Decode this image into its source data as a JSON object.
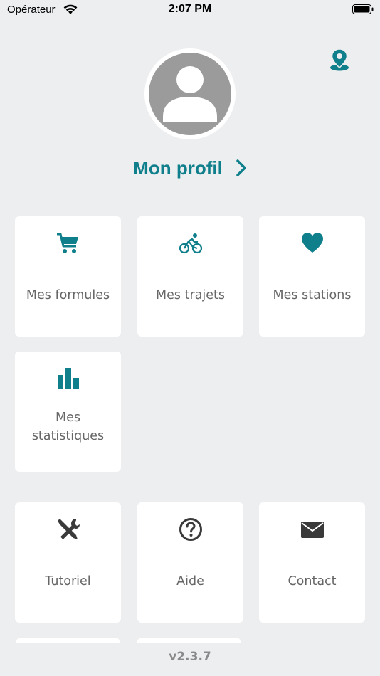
{
  "status_bar": {
    "carrier": "Opérateur",
    "time": "2:07 PM"
  },
  "colors": {
    "accent": "#0e7f8b",
    "background": "#eceef0",
    "tile": "#ffffff",
    "avatar": "#9b9b9b",
    "label": "#666666",
    "icon_dark": "#3a3a3a"
  },
  "header": {
    "map_icon": "map-pin-icon",
    "avatar_icon": "user-avatar-icon",
    "profile_label": "Mon profil"
  },
  "tiles_main": [
    {
      "icon": "cart-icon",
      "label": "Mes formules"
    },
    {
      "icon": "bicycle-icon",
      "label": "Mes trajets"
    },
    {
      "icon": "heart-icon",
      "label": "Mes stations"
    },
    {
      "icon": "bar-chart-icon",
      "label": "Mes statistiques"
    }
  ],
  "tiles_secondary": [
    {
      "icon": "tools-icon",
      "label": "Tutoriel"
    },
    {
      "icon": "help-icon",
      "label": "Aide"
    },
    {
      "icon": "mail-icon",
      "label": "Contact"
    }
  ],
  "footer": {
    "version": "v2.3.7"
  }
}
